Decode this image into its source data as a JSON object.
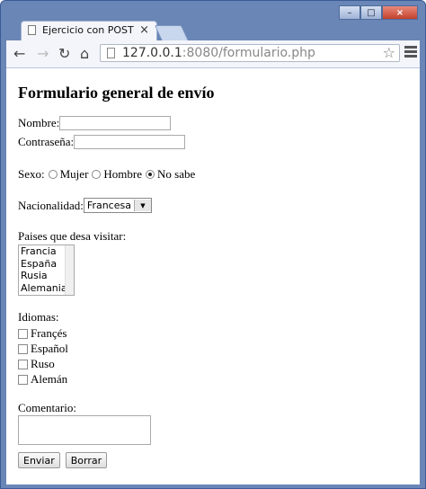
{
  "browser": {
    "tab_title": "Ejercicio con POST",
    "tab_close": "×",
    "url_host": "127.0.0.1",
    "url_rest": ":8080/formulario.php",
    "window_buttons": [
      "–",
      "□",
      "×"
    ]
  },
  "form": {
    "heading": "Formulario general de envío",
    "nombre_label": "Nombre:",
    "contrasena_label": "Contraseña:",
    "sexo_label": "Sexo:",
    "sexo_options": [
      "Mujer",
      "Hombre",
      "No sabe"
    ],
    "sexo_selected": "No sabe",
    "nacionalidad_label": "Nacionalidad:",
    "nacionalidad_value": "Francesa",
    "paises_label": "Paises que desa visitar:",
    "paises_options": [
      "Francia",
      "España",
      "Rusia",
      "Alemania"
    ],
    "idiomas_label": "Idiomas:",
    "idiomas_options": [
      "Françés",
      "Español",
      "Ruso",
      "Alemán"
    ],
    "comentario_label": "Comentario:",
    "enviar_label": "Enviar",
    "borrar_label": "Borrar"
  }
}
